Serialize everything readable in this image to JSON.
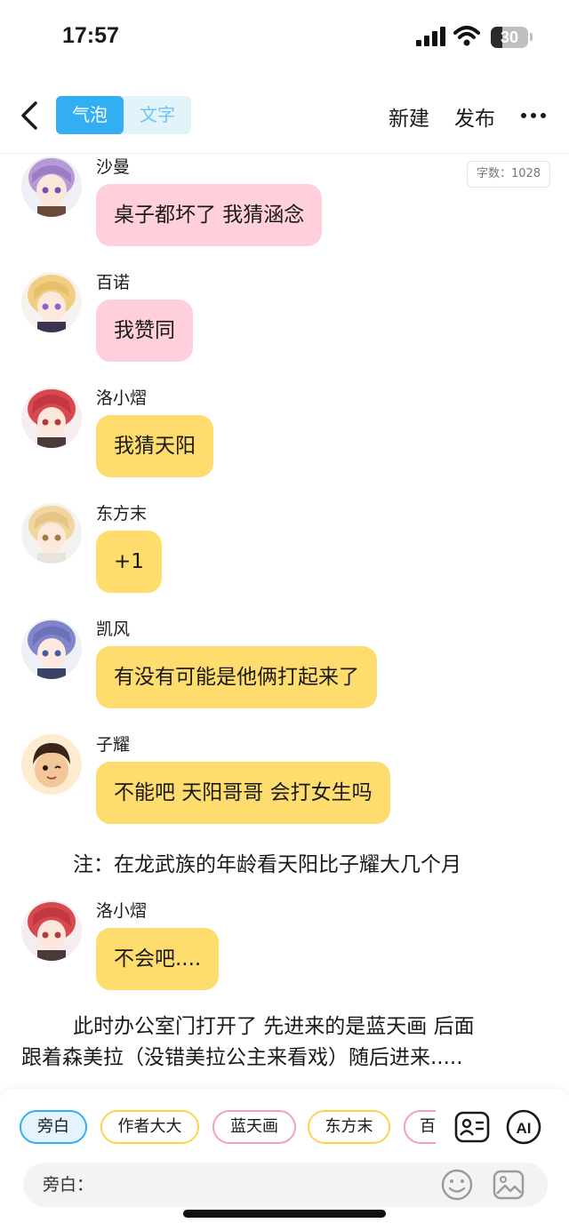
{
  "status_bar": {
    "time": "17:57",
    "battery": "30",
    "battery_level": 0.3
  },
  "nav": {
    "tabs": [
      {
        "label": "气泡",
        "active": true
      },
      {
        "label": "文字",
        "active": false
      }
    ],
    "new_label": "新建",
    "publish_label": "发布"
  },
  "word_count": "字数：1028",
  "messages": [
    {
      "name": "沙曼",
      "text": "桌子都坏了 我猜涵念",
      "bubble_color": "#ffd0dc",
      "avatar": "purple-hair-avatar"
    },
    {
      "name": "百诺",
      "text": "我赞同",
      "bubble_color": "#ffd0dc",
      "avatar": "blonde-hair-avatar"
    },
    {
      "name": "洛小熠",
      "text": "我猜天阳",
      "bubble_color": "#ffdc6e",
      "avatar": "red-hair-avatar"
    },
    {
      "name": "东方末",
      "text": "+1",
      "bubble_color": "#ffdc6e",
      "avatar": "light-blonde-avatar"
    },
    {
      "name": "凯风",
      "text": "有没有可能是他俩打起来了",
      "bubble_color": "#ffdc6e",
      "avatar": "blue-hair-avatar"
    },
    {
      "name": "子耀",
      "text": "不能吧 天阳哥哥 会打女生吗",
      "bubble_color": "#ffdc6e",
      "avatar": "winking-boy-avatar"
    },
    {
      "name": "洛小熠",
      "text": "不会吧....",
      "bubble_color": "#ffdc6e",
      "avatar": "red-hair-avatar"
    }
  ],
  "note": "注：在龙武族的年龄看天阳比子耀大几个月",
  "narration": {
    "line1": "此时办公室门打开了 先进来的是蓝天画 后面",
    "line2": "跟着森美拉（没错美拉公主来看戏）随后进来....."
  },
  "characters": [
    "旁白",
    "作者大大",
    "蓝天画",
    "东方末",
    "百"
  ],
  "input": {
    "label": "旁白："
  },
  "colors": {
    "accent": "#33aef3",
    "pink_bubble": "#ffd0dc",
    "yellow_bubble": "#ffdc6e"
  }
}
